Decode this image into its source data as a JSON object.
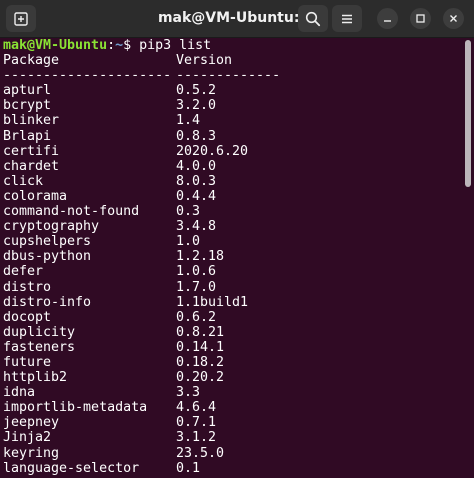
{
  "window": {
    "title": "mak@VM-Ubuntu: ~",
    "buttons": [
      "new-tab-icon",
      "search-icon",
      "hamburger-menu-icon",
      "minimize-icon",
      "maximize-icon",
      "close-icon"
    ]
  },
  "terminal": {
    "prompt_user": "mak@VM-Ubuntu",
    "prompt_sep": ":",
    "prompt_path": "~",
    "prompt_end": "$ ",
    "command": "pip3 list",
    "header": {
      "col1": "Package",
      "col2": "Version"
    },
    "rule": {
      "col1": "---------------------",
      "col2": "-------------"
    },
    "packages": [
      {
        "name": "apturl",
        "version": "0.5.2"
      },
      {
        "name": "bcrypt",
        "version": "3.2.0"
      },
      {
        "name": "blinker",
        "version": "1.4"
      },
      {
        "name": "Brlapi",
        "version": "0.8.3"
      },
      {
        "name": "certifi",
        "version": "2020.6.20"
      },
      {
        "name": "chardet",
        "version": "4.0.0"
      },
      {
        "name": "click",
        "version": "8.0.3"
      },
      {
        "name": "colorama",
        "version": "0.4.4"
      },
      {
        "name": "command-not-found",
        "version": "0.3"
      },
      {
        "name": "cryptography",
        "version": "3.4.8"
      },
      {
        "name": "cupshelpers",
        "version": "1.0"
      },
      {
        "name": "dbus-python",
        "version": "1.2.18"
      },
      {
        "name": "defer",
        "version": "1.0.6"
      },
      {
        "name": "distro",
        "version": "1.7.0"
      },
      {
        "name": "distro-info",
        "version": "1.1build1"
      },
      {
        "name": "docopt",
        "version": "0.6.2"
      },
      {
        "name": "duplicity",
        "version": "0.8.21"
      },
      {
        "name": "fasteners",
        "version": "0.14.1"
      },
      {
        "name": "future",
        "version": "0.18.2"
      },
      {
        "name": "httplib2",
        "version": "0.20.2"
      },
      {
        "name": "idna",
        "version": "3.3"
      },
      {
        "name": "importlib-metadata",
        "version": "4.6.4"
      },
      {
        "name": "jeepney",
        "version": "0.7.1"
      },
      {
        "name": "Jinja2",
        "version": "3.1.2"
      },
      {
        "name": "keyring",
        "version": "23.5.0"
      },
      {
        "name": "language-selector",
        "version": "0.1"
      }
    ]
  },
  "colors": {
    "background": "#300a24",
    "titlebar": "#2c2c2c",
    "prompt_user": "#8ae234",
    "prompt_path": "#729fcf",
    "text": "#ffffff"
  }
}
